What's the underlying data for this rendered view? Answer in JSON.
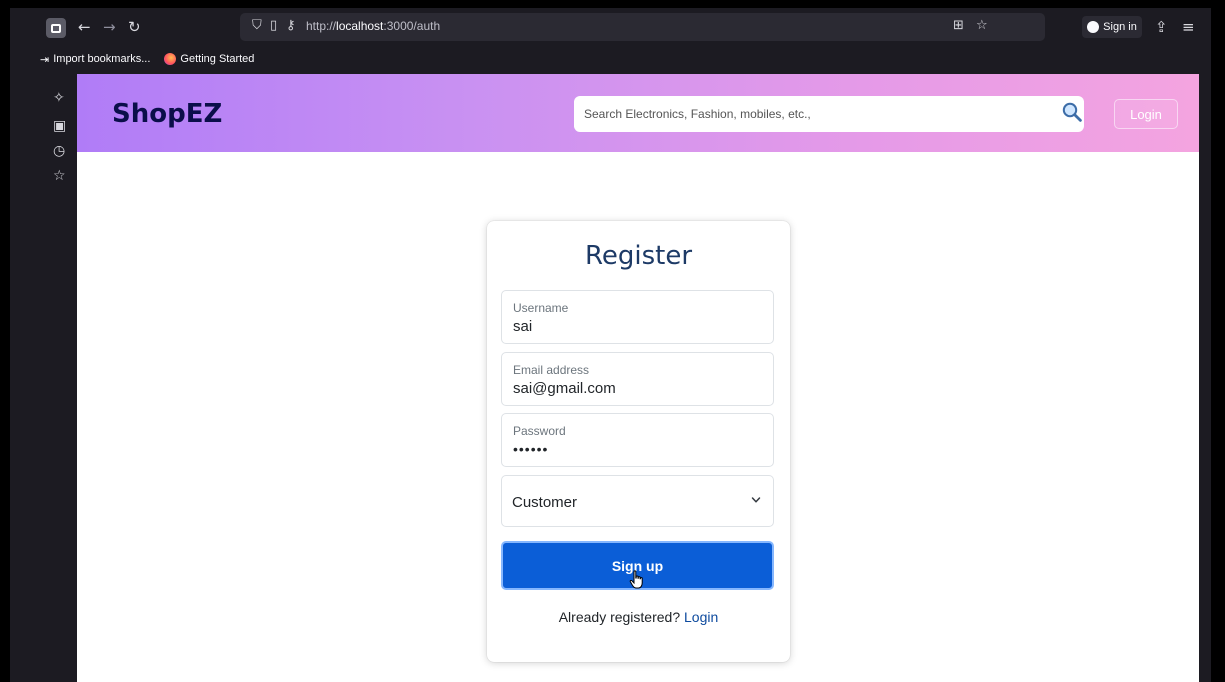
{
  "browser": {
    "url_prefix": "http://",
    "url_host": "localhost",
    "url_rest": ":3000/auth",
    "signin_label": "Sign in",
    "bookmarks": [
      {
        "label": "Import bookmarks...",
        "icon": "import-icon"
      },
      {
        "label": "Getting Started",
        "icon": "firefox-icon"
      }
    ]
  },
  "navbar": {
    "brand": "ShopEZ",
    "search_placeholder": "Search Electronics, Fashion, mobiles, etc.,",
    "login_label": "Login",
    "colors": {
      "gradient_start": "#b07cf7",
      "gradient_end": "#f4a4e0",
      "brand": "#0b0e4a"
    }
  },
  "register": {
    "title": "Register",
    "username_label": "Username",
    "username_value": "sai",
    "email_label": "Email address",
    "email_value": "sai@gmail.com",
    "password_label": "Password",
    "password_value": "••••••",
    "role_value": "Customer",
    "submit_label": "Sign up",
    "switch_prompt": "Already registered?",
    "switch_link": "Login",
    "colors": {
      "primary": "#0b5ed7",
      "title": "#1d3a66"
    }
  }
}
